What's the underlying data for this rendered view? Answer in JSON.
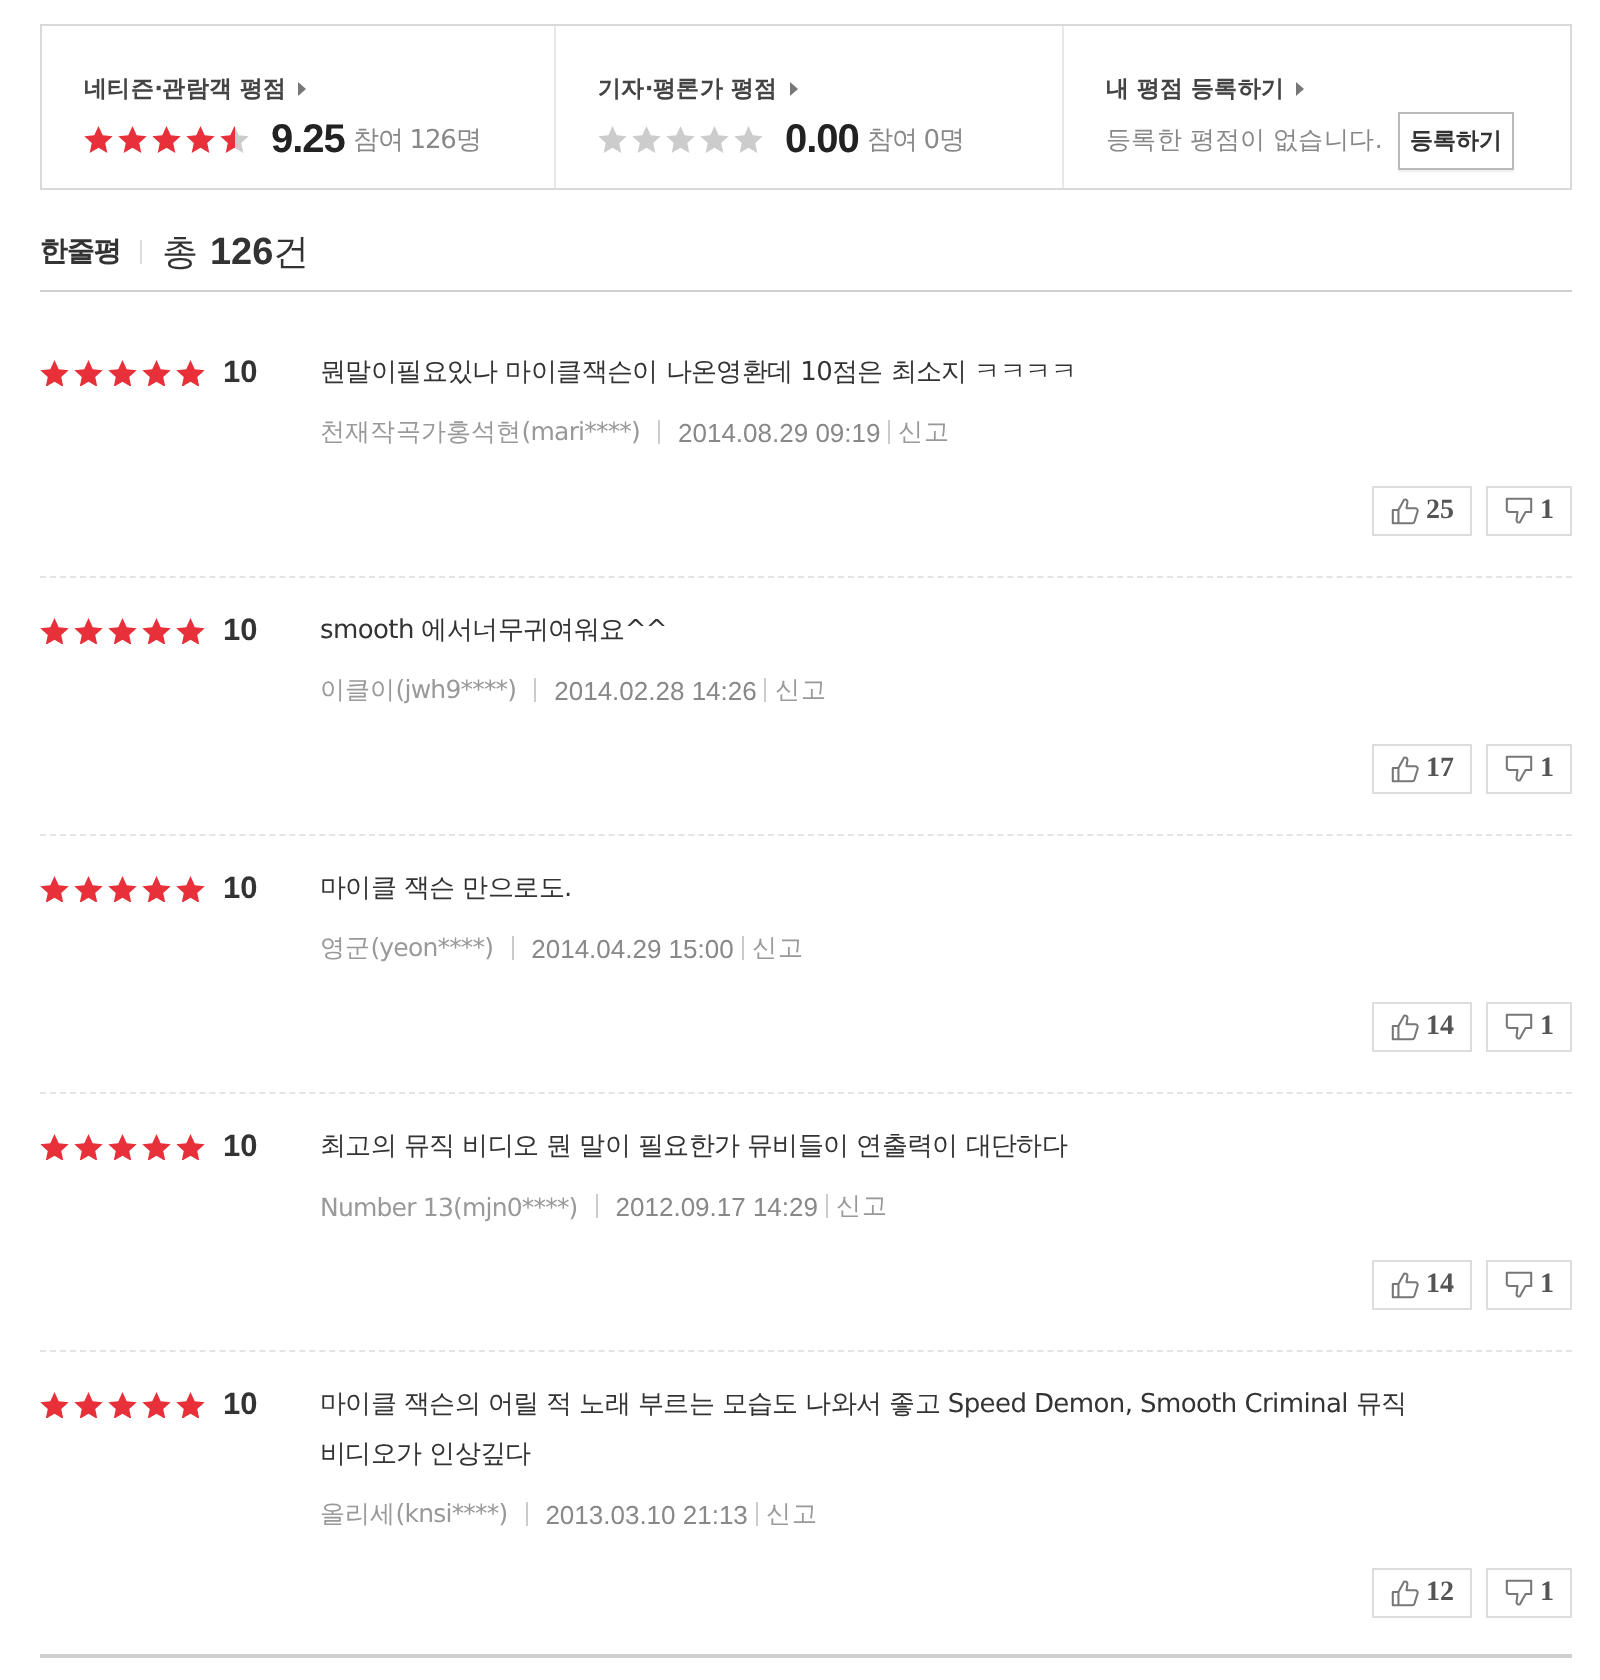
{
  "summary": [
    {
      "kind": "rating",
      "title": "네티즌·관람객 평점",
      "stars": 4.5,
      "score": "9.25",
      "participants": "참여 126명"
    },
    {
      "kind": "rating",
      "title": "기자·평론가 평점",
      "stars": 0,
      "score": "0.00",
      "participants": "참여 0명"
    },
    {
      "kind": "register",
      "title": "내 평점 등록하기",
      "message": "등록한 평점이 없습니다.",
      "button": "등록하기"
    }
  ],
  "header": {
    "title": "한줄평",
    "total": "총 **126**건"
  },
  "reviews": [
    {
      "stars": 5,
      "score": "10",
      "comment": "뭔말이필요있나 마이클잭슨이 나온영환데 10점은 최소지 ㅋㅋㅋㅋ",
      "author": "천재작곡가홍석현(mari****)",
      "date": "2014.08.29 09:19",
      "report": "신고",
      "likes": "25",
      "dislikes": "1"
    },
    {
      "stars": 5,
      "score": "10",
      "comment": "smooth 에서너무귀여워요^^",
      "author": "이클이(jwh9****)",
      "date": "2014.02.28 14:26",
      "report": "신고",
      "likes": "17",
      "dislikes": "1"
    },
    {
      "stars": 5,
      "score": "10",
      "comment": "마이클 잭슨 만으로도.",
      "author": "영군(yeon****)",
      "date": "2014.04.29 15:00",
      "report": "신고",
      "likes": "14",
      "dislikes": "1"
    },
    {
      "stars": 5,
      "score": "10",
      "comment": "최고의 뮤직 비디오 뭔 말이 필요한가 뮤비들이 연출력이 대단하다",
      "author": "Number 13(mjn0****)",
      "date": "2012.09.17 14:29",
      "report": "신고",
      "likes": "14",
      "dislikes": "1"
    },
    {
      "stars": 5,
      "score": "10",
      "comment": "마이클 잭슨의 어릴 적 노래 부르는 모습도 나와서 좋고 Speed Demon, Smooth Criminal 뮤직 비디오가 인상깊다",
      "author": "올리세(knsi****)",
      "date": "2013.03.10 21:13",
      "report": "신고",
      "likes": "12",
      "dislikes": "1"
    }
  ]
}
